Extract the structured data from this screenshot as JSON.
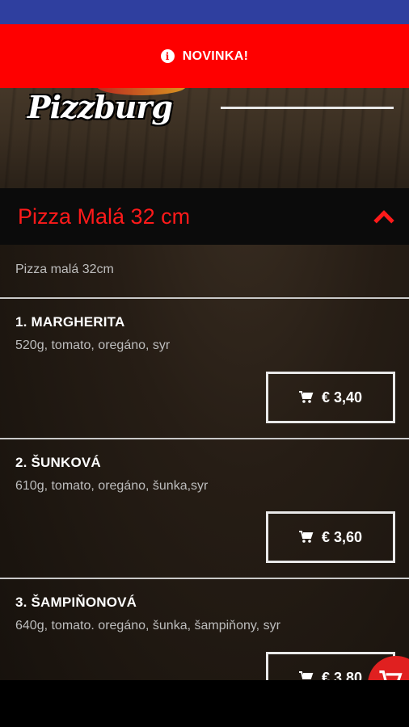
{
  "header": {
    "logo_text": "Pizzburg"
  },
  "notice": {
    "icon": "info-icon",
    "label": "NOVINKA!"
  },
  "category": {
    "title": "Pizza Malá 32 cm",
    "description": "Pizza malá 32cm",
    "toggle_icon": "chevron-up-icon"
  },
  "items": [
    {
      "name": "1. MARGHERITA",
      "description": "520g, tomato, oregáno, syr",
      "price": "€ 3,40"
    },
    {
      "name": "2. ŠUNKOVÁ",
      "description": "610g, tomato, oregáno, šunka,syr",
      "price": "€ 3,60"
    },
    {
      "name": "3. ŠAMPIŇONOVÁ",
      "description": "640g, tomato. oregáno, šunka, šampiňony, syr",
      "price": "€ 3,80"
    }
  ],
  "colors": {
    "status_bar": "#2f3f9f",
    "accent_red": "#fe0000",
    "category_bar": "#0b0b0b"
  }
}
